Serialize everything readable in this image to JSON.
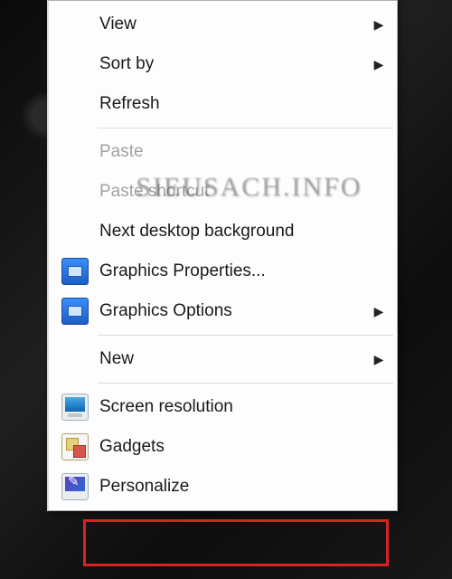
{
  "watermark": "SIEUSACH.INFO",
  "menu": {
    "view": {
      "label": "View",
      "hasSubmenu": true
    },
    "sortby": {
      "label": "Sort by",
      "hasSubmenu": true
    },
    "refresh": {
      "label": "Refresh"
    },
    "paste": {
      "label": "Paste",
      "disabled": true
    },
    "pasteShortcut": {
      "label": "Paste shortcut",
      "disabled": true
    },
    "nextBg": {
      "label": "Next desktop background"
    },
    "gfxProps": {
      "label": "Graphics Properties..."
    },
    "gfxOpts": {
      "label": "Graphics Options",
      "hasSubmenu": true
    },
    "new": {
      "label": "New",
      "hasSubmenu": true
    },
    "screenRes": {
      "label": "Screen resolution"
    },
    "gadgets": {
      "label": "Gadgets"
    },
    "personalize": {
      "label": "Personalize"
    }
  }
}
